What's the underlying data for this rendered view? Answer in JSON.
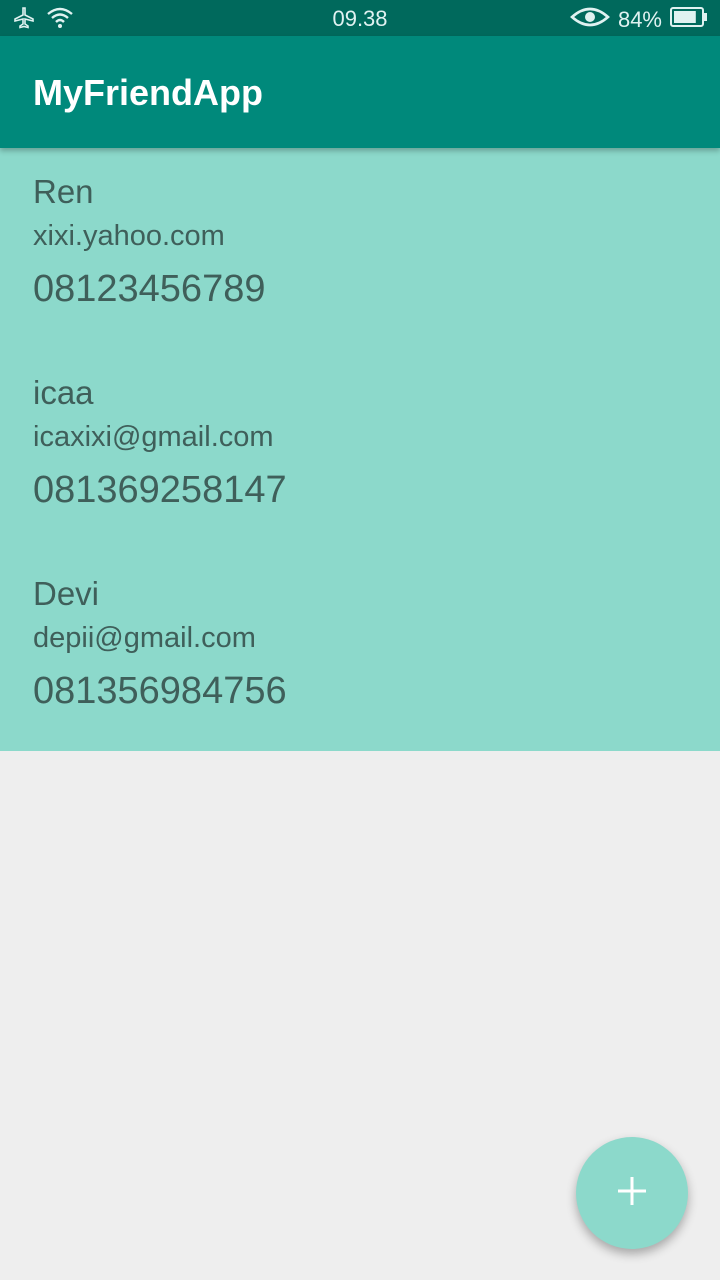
{
  "status_bar": {
    "time": "09.38",
    "battery_percent": "84%",
    "battery_level": 0.84,
    "icons": [
      "airplane-icon",
      "wifi-icon",
      "eye-icon",
      "battery-icon"
    ]
  },
  "app_bar": {
    "title": "MyFriendApp"
  },
  "friends": [
    {
      "name": "Ren",
      "email": "xixi.yahoo.com",
      "phone": "08123456789"
    },
    {
      "name": "icaa",
      "email": "icaxixi@gmail.com",
      "phone": "081369258147"
    },
    {
      "name": "Devi",
      "email": "depii@gmail.com",
      "phone": "081356984756"
    }
  ],
  "fab": {
    "icon": "plus-icon"
  },
  "colors": {
    "status_bar": "#00695c",
    "app_bar": "#00897b",
    "list_background": "#8cd9cb",
    "page_background": "#eeeeee",
    "text": "#3f5f5a"
  }
}
